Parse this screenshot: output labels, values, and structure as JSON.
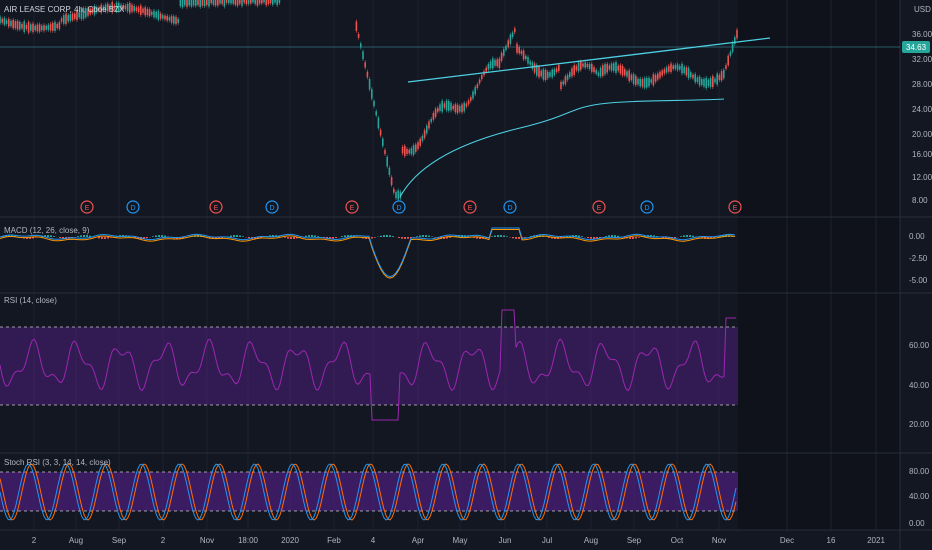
{
  "header": {
    "title": "AIR LEASE CORP, 4h, Cboe BZX",
    "currency": "USD"
  },
  "price_tag": "34.63",
  "price_axis": [
    "40.00",
    "36.00",
    "32.00",
    "28.00",
    "24.00",
    "20.00",
    "16.00",
    "12.00",
    "8.00"
  ],
  "macd_axis": [
    "0.00",
    "-2.50",
    "-5.00"
  ],
  "rsi_axis": [
    "60.00",
    "40.00",
    "20.00"
  ],
  "stoch_axis": [
    "80.00",
    "40.00",
    "0.00"
  ],
  "time_axis": [
    "2",
    "Aug",
    "Sep",
    "2",
    "Nov",
    "18:00",
    "2020",
    "Feb",
    "4",
    "Apr",
    "May",
    "Jun",
    "Jul",
    "Aug",
    "Sep",
    "Oct",
    "Nov",
    "Dec",
    "16",
    "2021"
  ],
  "panes": {
    "macd": {
      "label": "MACD (12, 26, close, 9)"
    },
    "rsi": {
      "label": "RSI (14, close)"
    },
    "stoch": {
      "label": "Stoch RSI (3, 3, 14, 14, close)"
    }
  },
  "events": [
    "E",
    "D",
    "E",
    "D",
    "E",
    "D",
    "E",
    "D",
    "E",
    "D",
    "E"
  ],
  "colors": {
    "bg": "#131722",
    "up": "#26a69a",
    "down": "#ef5350",
    "trend": "#4dd0e1",
    "macd": "#2196f3",
    "signal": "#ff9800",
    "rsi": "#9c27b0",
    "stoch_k": "#2196f3",
    "stoch_d": "#ff6d00",
    "event_e": "#ef5350",
    "event_d": "#2196f3"
  }
}
